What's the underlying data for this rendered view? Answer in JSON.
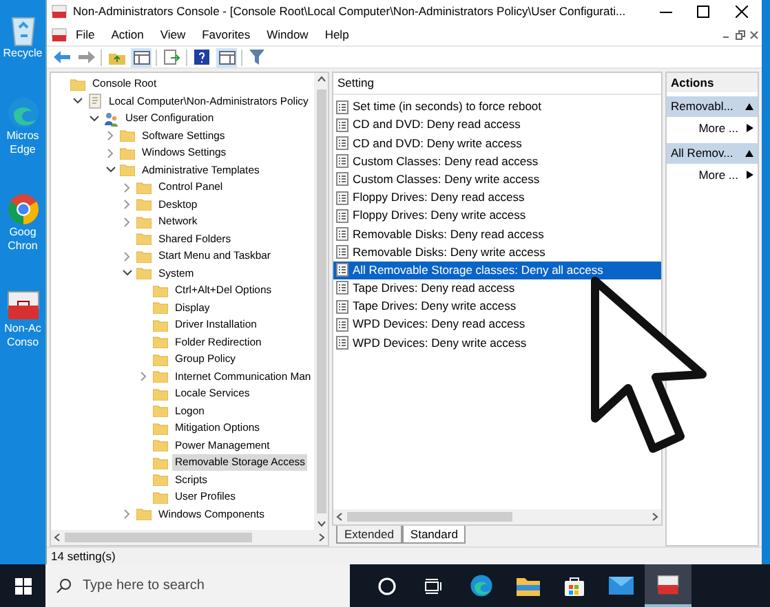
{
  "desktop_icons": [
    {
      "kind": "recycle",
      "lines": [
        "Recycle"
      ]
    },
    {
      "kind": "edge",
      "lines": [
        "Micros",
        "Edge"
      ]
    },
    {
      "kind": "chrome",
      "lines": [
        "Goog",
        "Chron"
      ]
    },
    {
      "kind": "toolbox",
      "lines": [
        "Non-Ac",
        "Conso"
      ]
    }
  ],
  "window": {
    "title": "Non-Administrators Console - [Console Root\\Local Computer\\Non-Administrators Policy\\User Configurati..."
  },
  "menu": [
    "File",
    "Action",
    "View",
    "Favorites",
    "Window",
    "Help"
  ],
  "tree": [
    {
      "label": "Console Root",
      "selected": false,
      "children": [
        {
          "label": "Local Computer\\Non-Administrators Policy",
          "expanded": true,
          "selected": false,
          "children": [
            {
              "label": "User Configuration",
              "expanded": true,
              "selected": false,
              "children": [
                {
                  "label": "Software Settings",
                  "expanded": false,
                  "selected": false
                },
                {
                  "label": "Windows Settings",
                  "expanded": false,
                  "selected": false
                },
                {
                  "label": "Administrative Templates",
                  "expanded": true,
                  "selected": false,
                  "children": [
                    {
                      "label": "Control Panel",
                      "expanded": false,
                      "selected": false
                    },
                    {
                      "label": "Desktop",
                      "expanded": false,
                      "selected": false
                    },
                    {
                      "label": "Network",
                      "expanded": false,
                      "selected": false
                    },
                    {
                      "label": "Shared Folders",
                      "selected": false
                    },
                    {
                      "label": "Start Menu and Taskbar",
                      "expanded": false,
                      "selected": false
                    },
                    {
                      "label": "System",
                      "expanded": true,
                      "selected": false,
                      "children": [
                        {
                          "label": "Ctrl+Alt+Del Options",
                          "selected": false
                        },
                        {
                          "label": "Display",
                          "selected": false
                        },
                        {
                          "label": "Driver Installation",
                          "selected": false
                        },
                        {
                          "label": "Folder Redirection",
                          "selected": false
                        },
                        {
                          "label": "Group Policy",
                          "selected": false
                        },
                        {
                          "label": "Internet Communication Man",
                          "expanded": false,
                          "selected": false
                        },
                        {
                          "label": "Locale Services",
                          "selected": false
                        },
                        {
                          "label": "Logon",
                          "selected": false
                        },
                        {
                          "label": "Mitigation Options",
                          "selected": false
                        },
                        {
                          "label": "Power Management",
                          "selected": false
                        },
                        {
                          "label": "Removable Storage Access",
                          "selected": true
                        },
                        {
                          "label": "Scripts",
                          "selected": false
                        },
                        {
                          "label": "User Profiles",
                          "selected": false
                        }
                      ]
                    },
                    {
                      "label": "Windows Components",
                      "expanded": false,
                      "selected": false
                    }
                  ]
                }
              ]
            }
          ]
        }
      ]
    }
  ],
  "settings": {
    "column": "Setting",
    "rows": [
      {
        "label": "Set time (in seconds) to force reboot",
        "selected": false
      },
      {
        "label": "CD and DVD: Deny read access",
        "selected": false
      },
      {
        "label": "CD and DVD: Deny write access",
        "selected": false
      },
      {
        "label": "Custom Classes: Deny read access",
        "selected": false
      },
      {
        "label": "Custom Classes: Deny write access",
        "selected": false
      },
      {
        "label": "Floppy Drives: Deny read access",
        "selected": false
      },
      {
        "label": "Floppy Drives: Deny write access",
        "selected": false
      },
      {
        "label": "Removable Disks: Deny read access",
        "selected": false
      },
      {
        "label": "Removable Disks: Deny write access",
        "selected": false
      },
      {
        "label": "All Removable Storage classes: Deny all access",
        "selected": true
      },
      {
        "label": "Tape Drives: Deny read access",
        "selected": false
      },
      {
        "label": "Tape Drives: Deny write access",
        "selected": false
      },
      {
        "label": "WPD Devices: Deny read access",
        "selected": false
      },
      {
        "label": "WPD Devices: Deny write access",
        "selected": false
      }
    ],
    "tabs": [
      {
        "label": "Extended",
        "selected": false
      },
      {
        "label": "Standard",
        "selected": true
      }
    ]
  },
  "actions": {
    "title": "Actions",
    "sections": [
      {
        "header": "Removabl...",
        "items": [
          "More ..."
        ]
      },
      {
        "header": "All Remov...",
        "items": [
          "More ..."
        ]
      }
    ]
  },
  "status_bar": "14 setting(s)",
  "taskbar": {
    "search_placeholder": "Type here to search",
    "apps": [
      {
        "kind": "cortana",
        "selected": false
      },
      {
        "kind": "taskview",
        "selected": false
      },
      {
        "kind": "edge",
        "selected": false
      },
      {
        "kind": "explorer",
        "selected": false
      },
      {
        "kind": "store",
        "selected": false
      },
      {
        "kind": "mail",
        "selected": false
      },
      {
        "kind": "console",
        "selected": true
      }
    ]
  }
}
